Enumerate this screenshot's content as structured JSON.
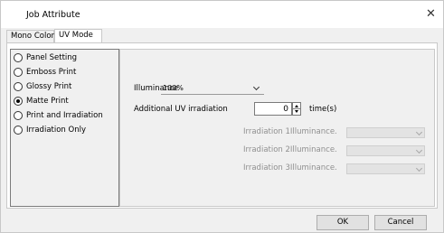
{
  "window": {
    "title": "Job Attribute"
  },
  "tabs": [
    {
      "label": "Mono Color"
    },
    {
      "label": "UV Mode"
    }
  ],
  "modes": [
    {
      "label": "Panel Setting",
      "checked": false
    },
    {
      "label": "Emboss Print",
      "checked": false
    },
    {
      "label": "Glossy Print",
      "checked": false
    },
    {
      "label": "Matte Print",
      "checked": true
    },
    {
      "label": "Print and Irradiation",
      "checked": false
    },
    {
      "label": "Irradiation Only",
      "checked": false
    }
  ],
  "illuminance": {
    "label": "Illuminance",
    "value": "100%"
  },
  "additional_uv": {
    "label": "Additional UV irradiation",
    "value": "0",
    "unit": "time(s)"
  },
  "irradiation": [
    {
      "label": "Irradiation 1Illuminance.",
      "value": ""
    },
    {
      "label": "Irradiation 2Illuminance.",
      "value": ""
    },
    {
      "label": "Irradiation 3Illuminance.",
      "value": ""
    }
  ],
  "buttons": {
    "ok": "OK",
    "cancel": "Cancel"
  },
  "icons": {
    "close": "close-icon",
    "dropdown": "chevron-down-icon",
    "spin_up": "arrow-up-icon",
    "spin_down": "arrow-down-icon"
  }
}
